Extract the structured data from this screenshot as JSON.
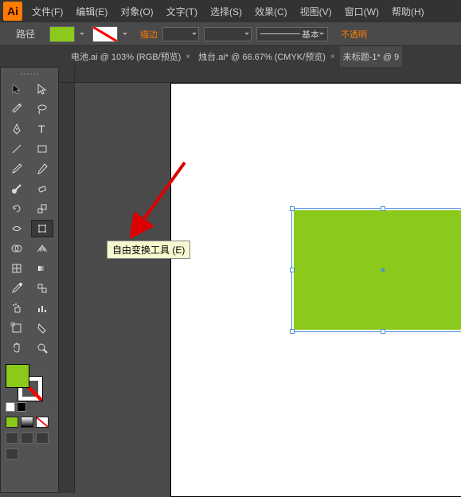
{
  "app": {
    "logo_text": "Ai"
  },
  "menu": {
    "file": "文件(F)",
    "edit": "编辑(E)",
    "object": "对象(O)",
    "type": "文字(T)",
    "select": "选择(S)",
    "effect": "效果(C)",
    "view": "视图(V)",
    "window": "窗口(W)",
    "help": "帮助(H)"
  },
  "controlbar": {
    "label": "路径",
    "fill_color": "#8bc91b",
    "stroke_label": "描边",
    "stroke_weight_empty": "",
    "profile_basic": "基本",
    "opacity_label": "不透明"
  },
  "tabs": [
    {
      "label": "电池.ai @ 103% (RGB/预览)"
    },
    {
      "label": "烛台.ai* @ 66.67% (CMYK/预览)"
    },
    {
      "label": "未标题-1* @ 9"
    }
  ],
  "tooltip": {
    "free_transform": "自由变换工具 (E)"
  },
  "tools": {
    "selection": "selection-tool",
    "direct": "direct-selection-tool",
    "magic_wand": "magic-wand-tool",
    "lasso": "lasso-tool",
    "pen": "pen-tool",
    "type": "type-tool",
    "line": "line-segment-tool",
    "rectangle": "rectangle-tool",
    "paintbrush": "paintbrush-tool",
    "pencil": "pencil-tool",
    "blob": "blob-brush-tool",
    "eraser": "eraser-tool",
    "rotate": "rotate-tool",
    "scale": "scale-tool",
    "width": "width-tool",
    "free_transform": "free-transform-tool",
    "shape_builder": "shape-builder-tool",
    "perspective": "perspective-grid-tool",
    "mesh": "mesh-tool",
    "gradient": "gradient-tool",
    "eyedropper": "eyedropper-tool",
    "blend": "blend-tool",
    "symbol": "symbol-sprayer-tool",
    "graph": "column-graph-tool",
    "artboard": "artboard-tool",
    "slice": "slice-tool",
    "hand": "hand-tool",
    "zoom": "zoom-tool"
  },
  "color_chips": {
    "fill": "#8bc91b",
    "white": "#ffffff",
    "none": "none"
  },
  "canvas": {
    "shape_fill": "#8bc91b"
  }
}
